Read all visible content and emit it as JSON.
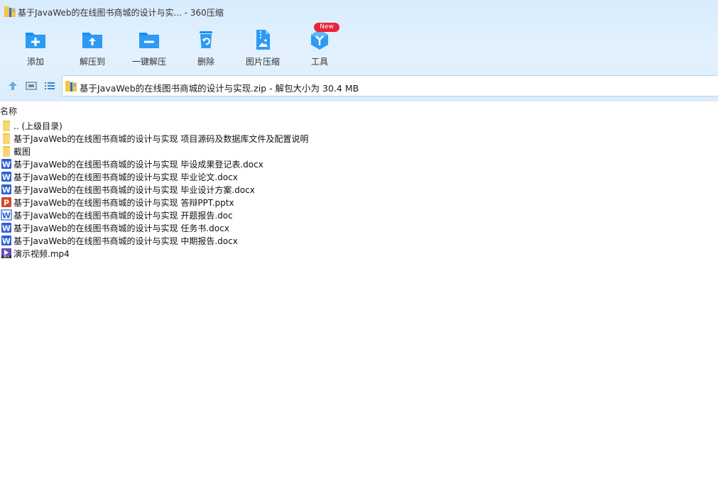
{
  "window": {
    "title": "基于JavaWeb的在线图书商城的设计与实... - 360压缩"
  },
  "toolbar": {
    "items": [
      {
        "label": "添加",
        "icon": "add-archive-icon"
      },
      {
        "label": "解压到",
        "icon": "extract-to-icon"
      },
      {
        "label": "一键解压",
        "icon": "one-click-extract-icon"
      },
      {
        "label": "删除",
        "icon": "delete-icon"
      },
      {
        "label": "图片压缩",
        "icon": "image-compress-icon"
      },
      {
        "label": "工具",
        "icon": "tools-icon"
      }
    ],
    "new_badge": "New"
  },
  "nav": {
    "address": "基于JavaWeb的在线图书商城的设计与实现.zip - 解包大小为 30.4 MB"
  },
  "list": {
    "header_name": "名称",
    "files": [
      {
        "name": ".. (上级目录)",
        "type": "folder"
      },
      {
        "name": "基于JavaWeb的在线图书商城的设计与实现 项目源码及数据库文件及配置说明",
        "type": "folder"
      },
      {
        "name": "截图",
        "type": "folder"
      },
      {
        "name": "基于JavaWeb的在线图书商城的设计与实现 毕设成果登记表.docx",
        "type": "docx"
      },
      {
        "name": "基于JavaWeb的在线图书商城的设计与实现 毕业论文.docx",
        "type": "docx"
      },
      {
        "name": "基于JavaWeb的在线图书商城的设计与实现 毕业设计方案.docx",
        "type": "docx"
      },
      {
        "name": "基于JavaWeb的在线图书商城的设计与实现 答辩PPT.pptx",
        "type": "pptx"
      },
      {
        "name": "基于JavaWeb的在线图书商城的设计与实现 开题报告.doc",
        "type": "doc"
      },
      {
        "name": "基于JavaWeb的在线图书商城的设计与实现 任务书.docx",
        "type": "docx"
      },
      {
        "name": "基于JavaWeb的在线图书商城的设计与实现 中期报告.docx",
        "type": "docx"
      },
      {
        "name": "演示视频.mp4",
        "type": "mp4"
      }
    ]
  },
  "colors": {
    "accent": "#1a8ff0",
    "toolbar_bg": "#e0effd",
    "badge": "#e8253a",
    "word": "#2b5fd0",
    "ppt": "#d8442a",
    "folder": "#f7d774"
  }
}
